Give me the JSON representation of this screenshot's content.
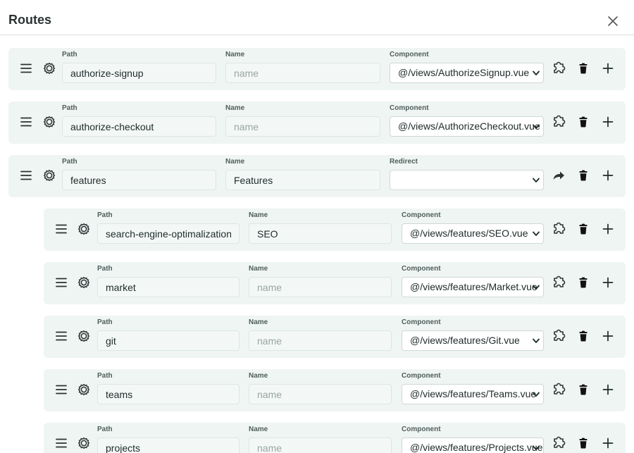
{
  "dialog": {
    "title": "Routes"
  },
  "labels": {
    "path": "Path",
    "name": "Name",
    "component": "Component",
    "redirect": "Redirect",
    "name_placeholder": "name"
  },
  "routes": [
    {
      "level": 0,
      "path": "authorize-signup",
      "name": "",
      "type": "component",
      "value": "@/views/AuthorizeSignup.vue"
    },
    {
      "level": 0,
      "path": "authorize-checkout",
      "name": "",
      "type": "component",
      "value": "@/views/AuthorizeCheckout.vue"
    },
    {
      "level": 0,
      "path": "features",
      "name": "Features",
      "type": "redirect",
      "value": ""
    },
    {
      "level": 1,
      "path": "search-engine-optimalization",
      "name": "SEO",
      "type": "component",
      "value": "@/views/features/SEO.vue"
    },
    {
      "level": 1,
      "path": "market",
      "name": "",
      "type": "component",
      "value": "@/views/features/Market.vue"
    },
    {
      "level": 1,
      "path": "git",
      "name": "",
      "type": "component",
      "value": "@/views/features/Git.vue"
    },
    {
      "level": 1,
      "path": "teams",
      "name": "",
      "type": "component",
      "value": "@/views/features/Teams.vue"
    },
    {
      "level": 1,
      "path": "projects",
      "name": "",
      "type": "component",
      "value": "@/views/features/Projects.vue"
    }
  ],
  "icons": {
    "close": "close-icon",
    "drag": "drag-handle-icon",
    "settings": "gear-icon",
    "component": "puzzle-icon",
    "redirect": "redirect-arrow-icon",
    "delete": "trash-icon",
    "add": "plus-icon"
  },
  "colors": {
    "row_background": "#eff5f3",
    "input_background": "#f3f8f6",
    "text": "#1e2a2a",
    "label": "#4f5e5c"
  }
}
